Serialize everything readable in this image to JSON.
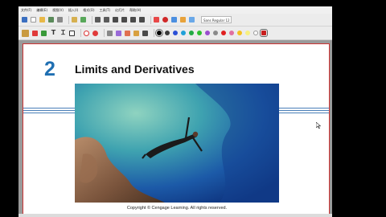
{
  "menu": [
    "文件(F)",
    "编辑(E)",
    "视图(V)",
    "插入(I)",
    "格式(O)",
    "工具(T)",
    "幻灯片",
    "帮助(H)"
  ],
  "toolbar": {
    "font_select": "Sans Regular  12",
    "colors": [
      "#000000",
      "#3a3a3a",
      "#2a4fd6",
      "#1fa0d8",
      "#22aa44",
      "#2ec02e",
      "#9a4dcf",
      "#8a8a8a",
      "#e02020",
      "#e070a0",
      "#f4c020",
      "#f8f080",
      "#ffffff",
      "#c81e1e"
    ]
  },
  "slide": {
    "chapter_number": "2",
    "chapter_title": "Limits and Derivatives",
    "copyright": "Copyright © Cengage Learning. All rights reserved."
  }
}
